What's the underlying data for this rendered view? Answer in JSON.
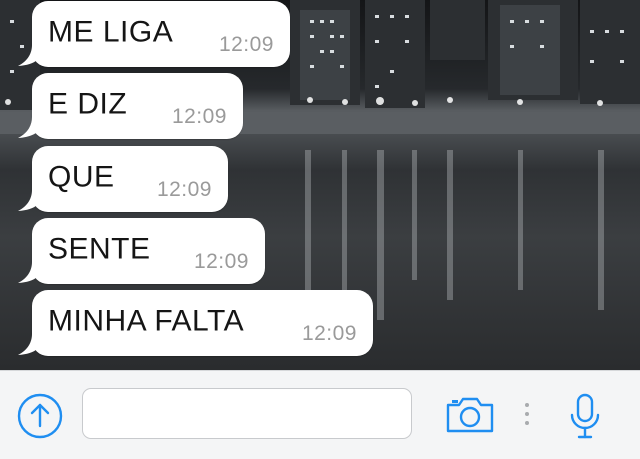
{
  "messages": [
    {
      "text": "ME LIGA",
      "time": "12:09"
    },
    {
      "text": "E DIZ",
      "time": "12:09"
    },
    {
      "text": "QUE",
      "time": "12:09"
    },
    {
      "text": "SENTE",
      "time": "12:09"
    },
    {
      "text": "MINHA FALTA",
      "time": "12:09"
    }
  ],
  "input_bar": {
    "message_value": "",
    "placeholder": ""
  },
  "colors": {
    "accent": "#1f8ef1",
    "bubble": "#ffffff",
    "timestamp": "#9a9a9a"
  },
  "icons": [
    "arrow-up-circle-icon",
    "camera-icon",
    "more-vertical-icon",
    "microphone-icon"
  ]
}
